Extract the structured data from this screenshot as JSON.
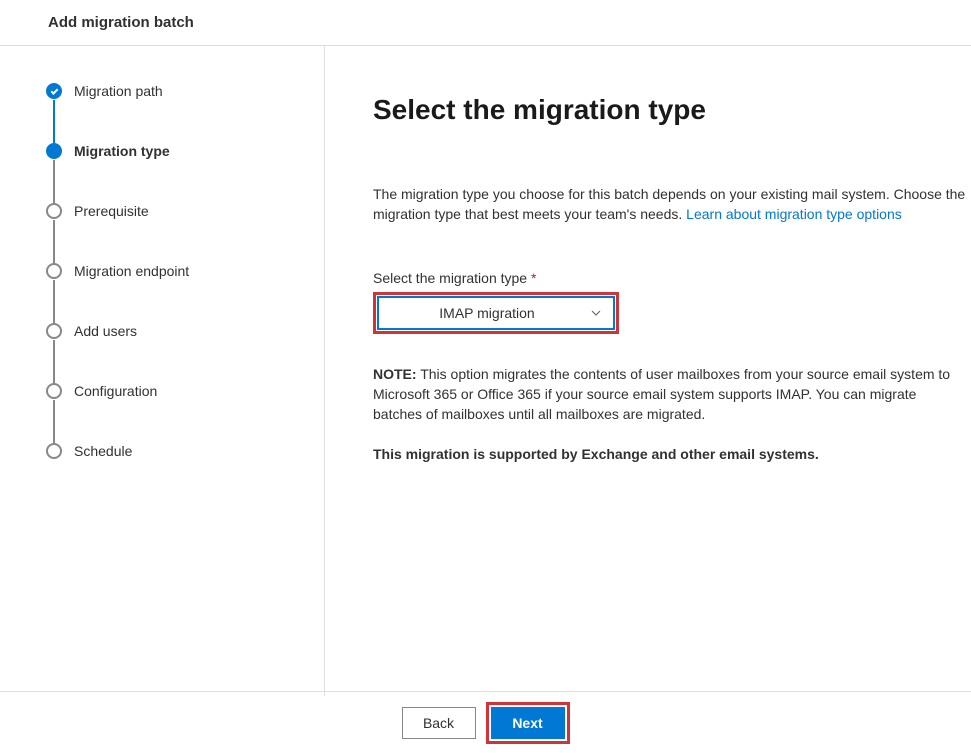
{
  "header": {
    "title": "Add migration batch"
  },
  "steps": [
    {
      "label": "Migration path",
      "state": "completed"
    },
    {
      "label": "Migration type",
      "state": "current"
    },
    {
      "label": "Prerequisite",
      "state": "upcoming"
    },
    {
      "label": "Migration endpoint",
      "state": "upcoming"
    },
    {
      "label": "Add users",
      "state": "upcoming"
    },
    {
      "label": "Configuration",
      "state": "upcoming"
    },
    {
      "label": "Schedule",
      "state": "upcoming"
    }
  ],
  "main": {
    "heading": "Select the migration type",
    "intro_before_link": "The migration type you choose for this batch depends on your existing mail system. Choose the migration type that best meets your team's needs. ",
    "intro_link": "Learn about migration type options",
    "field_label": "Select the migration type",
    "required_mark": "*",
    "selected_value": "IMAP migration",
    "note_label": "NOTE:",
    "note_text": " This option migrates the contents of user mailboxes from your source email system to Microsoft 365 or Office 365 if your source email system supports IMAP. You can migrate batches of mailboxes until all mailboxes are migrated.",
    "supported_text": "This migration is supported by Exchange and other email systems."
  },
  "footer": {
    "back": "Back",
    "next": "Next"
  },
  "highlight_color": "#d13438",
  "accent_color": "#0078d4"
}
